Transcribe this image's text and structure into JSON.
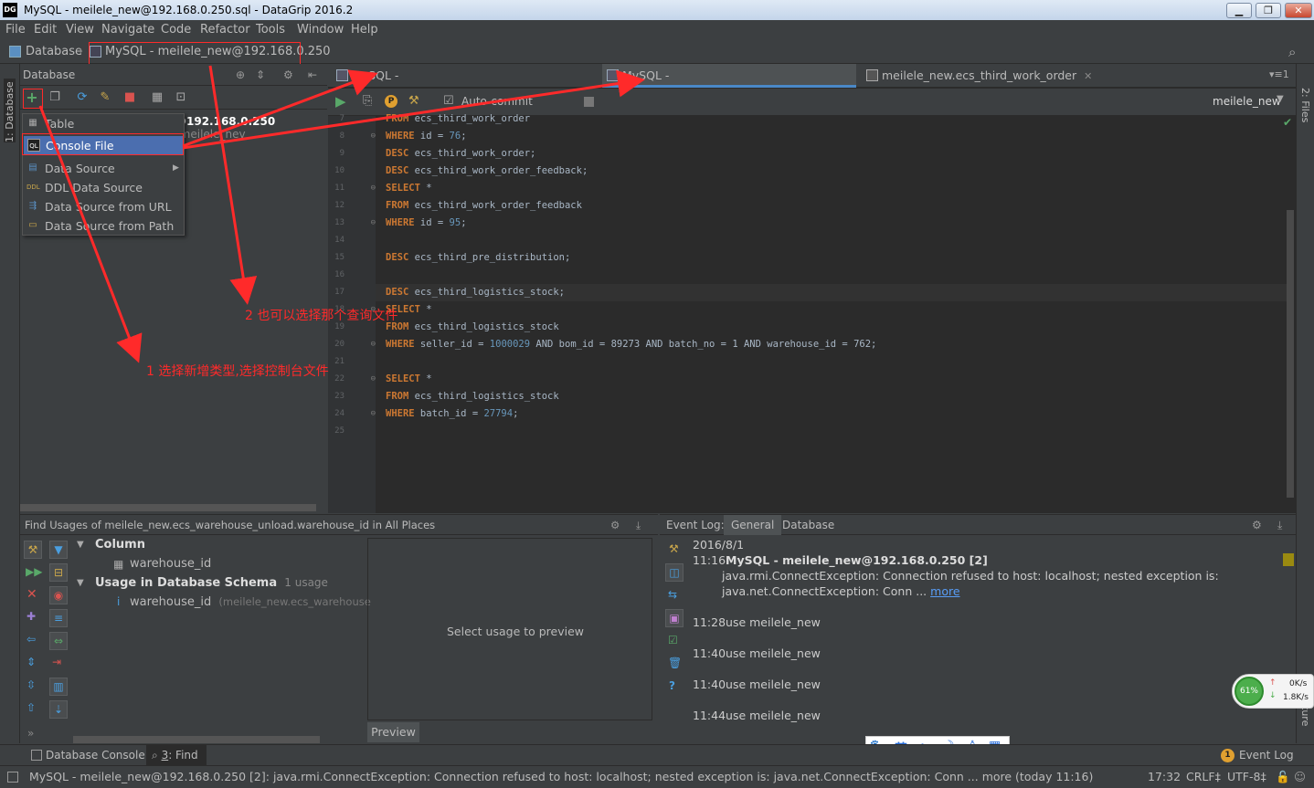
{
  "window": {
    "title": "MySQL - meilele_new@192.168.0.250.sql - DataGrip 2016.2",
    "logo": "DG",
    "min_label": "▁",
    "max_label": "❐",
    "close_label": "✕"
  },
  "menu": [
    "File",
    "Edit",
    "View",
    "Navigate",
    "Code",
    "Refactor",
    "Tools",
    "Window",
    "Help"
  ],
  "nav": {
    "item1": "Database",
    "item2": "MySQL - meilele_new@192.168.0.250"
  },
  "leftstrip": {
    "label": "1: Database"
  },
  "rightstrip": {
    "label": "2: Files",
    "label2": "ucture"
  },
  "dbpanel": {
    "title": "Database",
    "tree_node": "@192.168.0.250",
    "tree_node_sub": "(meilele_nev"
  },
  "popup": {
    "items": [
      "Table",
      "Console File",
      "Data Source",
      "DDL Data Source",
      "Data Source from URL",
      "Data Source from Path"
    ]
  },
  "tabs": [
    {
      "label": "MySQL - meilele_new@192.168.0.250_1.sql"
    },
    {
      "label": "MySQL - meilele_new@192.168.0.250.sql"
    },
    {
      "label": "meilele_new.ecs_third_work_order"
    }
  ],
  "tabs_overflow": "▾≡1",
  "editor_toolbar": {
    "autocommit": "Auto-commit",
    "schema": "meilele_new"
  },
  "code_lines": [
    {
      "n": "7",
      "kw": "FROM",
      "rest": " ecs_third_work_order"
    },
    {
      "n": "8",
      "kw": "WHERE",
      "rest": " id = ",
      "num": "76",
      "tail": ";"
    },
    {
      "n": "9",
      "kw": "DESC",
      "rest": " ecs_third_work_order;"
    },
    {
      "n": "10",
      "kw": "DESC",
      "rest": " ecs_third_work_order_feedback;"
    },
    {
      "n": "11",
      "kw": "SELECT",
      "rest": " *"
    },
    {
      "n": "12",
      "kw": "FROM",
      "rest": " ecs_third_work_order_feedback"
    },
    {
      "n": "13",
      "kw": "WHERE",
      "rest": " id = ",
      "num": "95",
      "tail": ";"
    },
    {
      "n": "14",
      "kw": "",
      "rest": ""
    },
    {
      "n": "15",
      "kw": "DESC",
      "rest": " ecs_third_pre_distribution;"
    },
    {
      "n": "16",
      "kw": "",
      "rest": ""
    },
    {
      "n": "17",
      "kw": "DESC",
      "rest": " ecs_third_logistics_stock;"
    },
    {
      "n": "18",
      "kw": "SELECT",
      "rest": " *"
    },
    {
      "n": "19",
      "kw": "FROM",
      "rest": " ecs_third_logistics_stock"
    },
    {
      "n": "20",
      "kw": "WHERE",
      "rest": " seller_id = ",
      "num": "1000029",
      "tail": " AND bom_id = 89273 AND batch_no = 1 AND warehouse_id = 762;"
    },
    {
      "n": "21",
      "kw": "",
      "rest": ""
    },
    {
      "n": "22",
      "kw": "SELECT",
      "rest": " *"
    },
    {
      "n": "23",
      "kw": "FROM",
      "rest": " ecs_third_logistics_stock"
    },
    {
      "n": "24",
      "kw": "WHERE",
      "rest": " batch_id = ",
      "num": "27794",
      "tail": ";"
    },
    {
      "n": "25",
      "kw": "",
      "rest": ""
    }
  ],
  "find": {
    "title": "Find Usages of meilele_new.ecs_warehouse_unload.warehouse_id in All Places",
    "column": "Column",
    "column_item": "warehouse_id",
    "usage": "Usage in Database Schema",
    "usage_count": "1 usage",
    "usage_item": "warehouse_id",
    "usage_item_sub": "(meilele_new.ecs_warehouse",
    "preview_placeholder": "Select usage to preview",
    "preview_tab": "Preview"
  },
  "eventlog": {
    "title": "Event Log:",
    "tab1": "General",
    "tab2": "Database",
    "date": "2016/8/1",
    "e1_time": "11:16",
    "e1_title": "MySQL - meilele_new@192.168.0.250 [2]",
    "e1_line1": "java.rmi.ConnectException: Connection refused to host: localhost; nested exception is:",
    "e1_line2": "java.net.ConnectException: Conn ...",
    "e1_more": "more",
    "e2": "11:28use meilele_new",
    "e3": "11:40use meilele_new",
    "e4": "11:40use meilele_new",
    "e5": "11:44use meilele_new"
  },
  "net": {
    "pct": "61%",
    "up": "0K/s",
    "down": "1.8K/s"
  },
  "ime": [
    "🐾",
    "英",
    "•,",
    "☽",
    "♙",
    "▦"
  ],
  "toolwin": {
    "db_console": "Database Console",
    "find_num": "3",
    "find": ": Find",
    "event_count": "1",
    "event": "Event Log"
  },
  "status": {
    "message": "MySQL - meilele_new@192.168.0.250 [2]: java.rmi.ConnectException: Connection refused to host: localhost; nested exception is: java.net.ConnectException: Conn ... more (today 11:16)",
    "time": "17:32",
    "crlf": "CRLF‡",
    "enc": "UTF-8‡"
  },
  "annotations": {
    "a1": "1 选择新增类型,选择控制台文件",
    "a2": "2 也可以选择那个查询文件"
  },
  "colors": {
    "accent": "#4b6eaf",
    "annotation": "#ff2a2a",
    "keyword": "#cc7832",
    "number": "#6897bb"
  }
}
